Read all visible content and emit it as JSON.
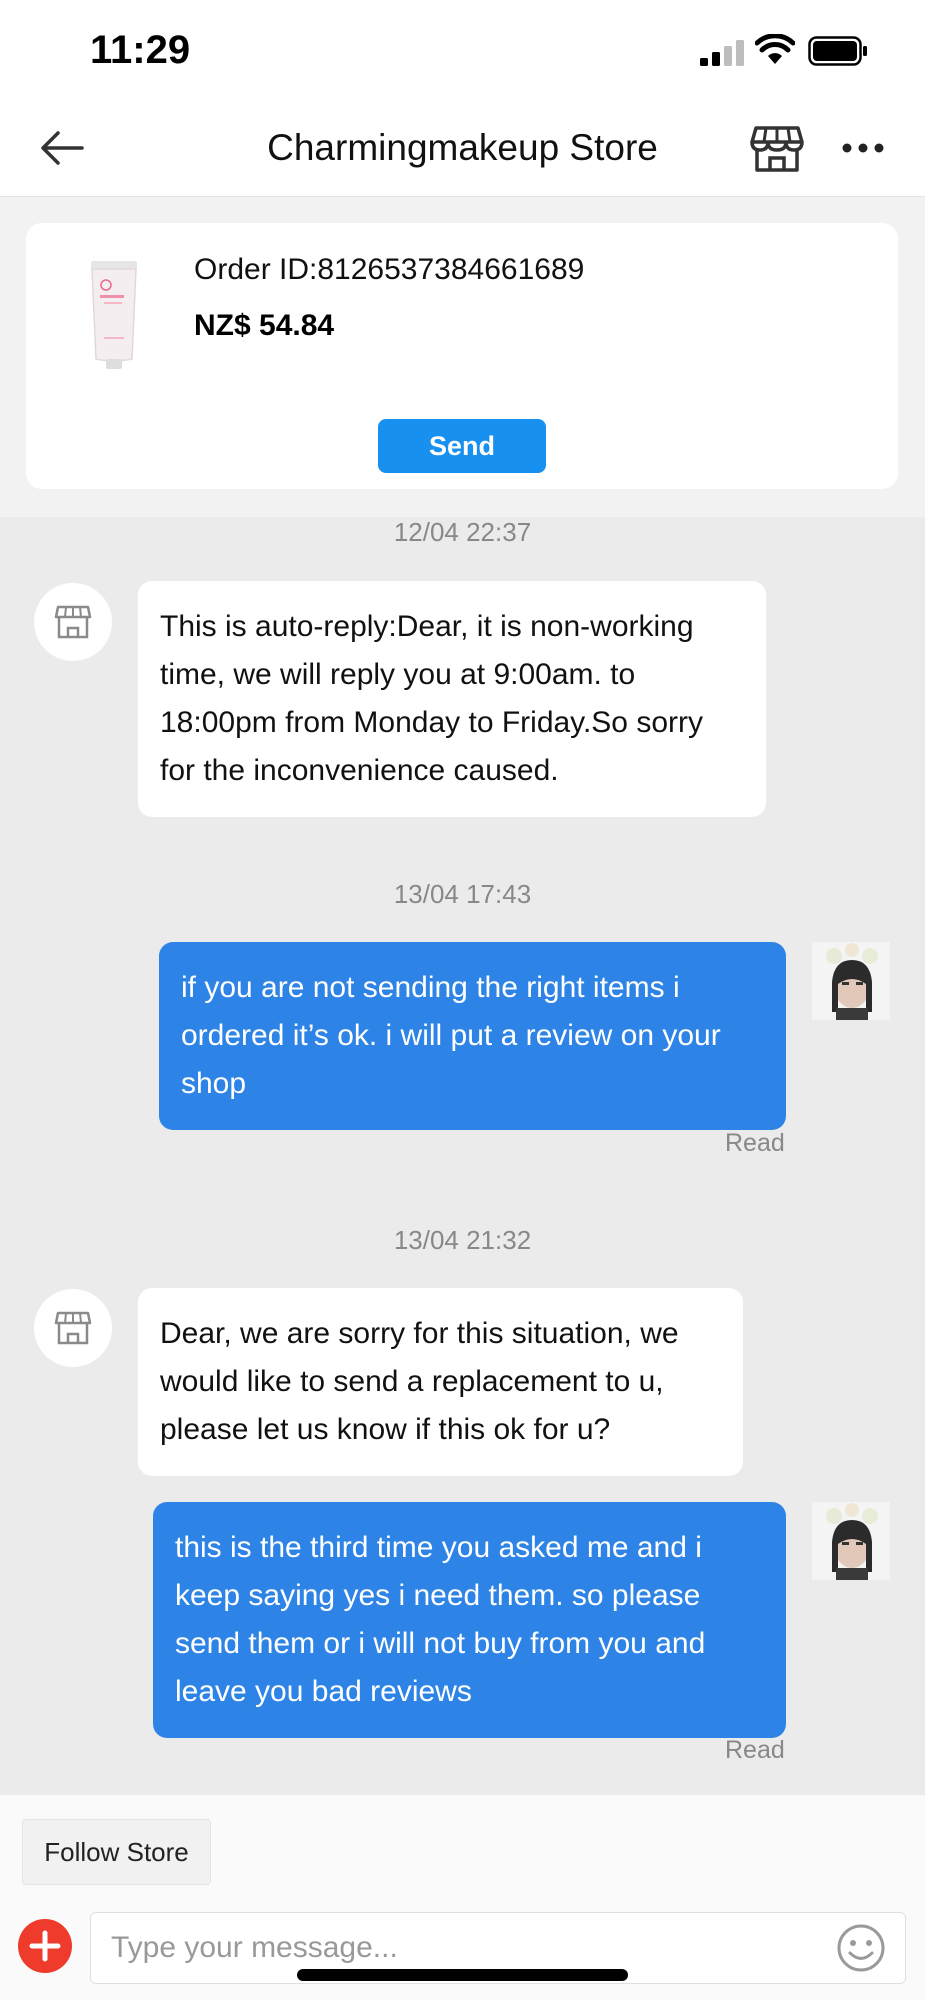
{
  "status_bar": {
    "time": "11:29"
  },
  "header": {
    "title": "Charmingmakeup Store",
    "back_icon": "back-arrow-icon",
    "store_icon": "store-icon",
    "more_icon": "more-icon"
  },
  "order": {
    "id_text": "Order ID:8126537384661689",
    "price": "NZ$ 54.84",
    "send_label": "Send"
  },
  "messages": [
    {
      "time": "12/04 22:37",
      "from": "store",
      "text": "This is auto-reply:Dear, it is non-working time, we will reply you at 9:00am. to 18:00pm from Monday to Friday.So sorry for the inconvenience caused."
    },
    {
      "time": "13/04 17:43",
      "from": "user",
      "text": "if you are not sending the right items i ordered it’s ok. i will put a review on your shop",
      "status": "Read"
    },
    {
      "time": "13/04 21:32",
      "from": "store",
      "text": "Dear, we are sorry for this situation, we would like to send a replacement to u, please let us know if this ok for u?"
    },
    {
      "from": "user",
      "text": "this is the third time you asked me and i keep saying yes i need them. so please send  them or i will not buy from you and leave you bad reviews",
      "status": "Read"
    }
  ],
  "bottom": {
    "follow_label": "Follow Store",
    "input_placeholder": "Type your message...",
    "input_value": ""
  },
  "colors": {
    "accent_blue": "#1890f0",
    "outgoing_bubble": "#2e84e6",
    "chat_background": "#ebebeb",
    "plus_button": "#ef3b2c"
  }
}
